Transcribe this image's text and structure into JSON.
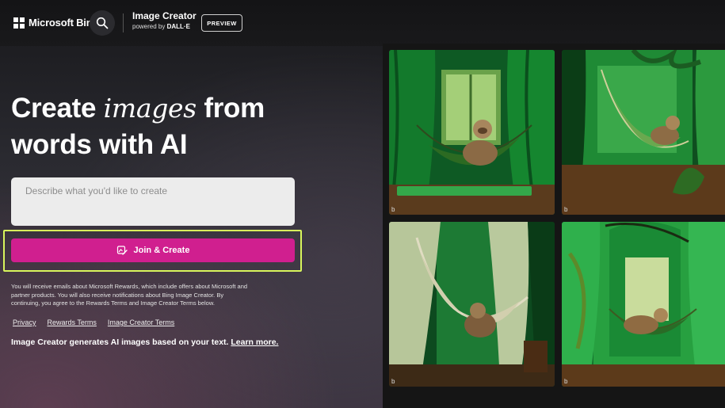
{
  "header": {
    "logo_text": "Microsoft Bing",
    "brand_title": "Image Creator",
    "brand_sub_prefix": "powered by",
    "brand_sub_model": "DALL·E",
    "preview_label": "PREVIEW"
  },
  "hero": {
    "title_word1": "Create",
    "title_italic": "images",
    "title_word2": "from",
    "title_line2": "words with AI"
  },
  "prompt": {
    "placeholder": "Describe what you'd like to create"
  },
  "join_button": {
    "label": "Join & Create"
  },
  "disclaimer": "You will receive emails about Microsoft Rewards, which include offers about Microsoft and partner products. You will also receive notifications about Bing Image Creator. By continuing, you agree to the Rewards Terms and Image Creator Terms below.",
  "links": [
    "Privacy",
    "Rewards Terms",
    "Image Creator Terms"
  ],
  "info": {
    "text": "Image Creator generates AI images based on your text.",
    "link": "Learn more."
  },
  "gallery": {
    "watermark": "b"
  },
  "colors": {
    "accent": "#d01f8f",
    "highlight": "#d8f55c"
  },
  "icons": [
    "windows-logo-icon",
    "search-icon",
    "image-create-icon"
  ]
}
